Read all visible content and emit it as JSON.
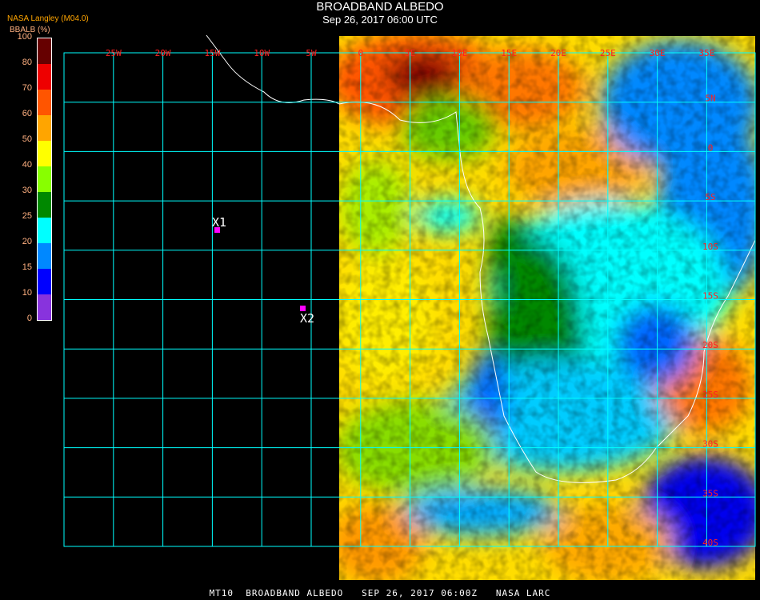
{
  "header": {
    "title": "BROADBAND ALBEDO",
    "subtitle": "Sep 26, 2017 06:00 UTC",
    "source": "NASA Langley (M04.0)",
    "unit": "BBALB (%)"
  },
  "legend": {
    "ticks": [
      "100",
      "80",
      "70",
      "60",
      "50",
      "40",
      "30",
      "25",
      "20",
      "15",
      "10",
      "0"
    ],
    "colors": [
      "#660000",
      "#ee0000",
      "#ff5500",
      "#ffa500",
      "#ffff00",
      "#88ff00",
      "#008800",
      "#00ffff",
      "#0088ff",
      "#0000ff",
      "#8833dd"
    ]
  },
  "map": {
    "lon_labels": [
      "25W",
      "20W",
      "15W",
      "10W",
      "5W",
      "0",
      "5E",
      "10E",
      "15E",
      "20E",
      "25E",
      "30E",
      "35E"
    ],
    "lat_labels": [
      "5N",
      "0",
      "5S",
      "10S",
      "15S",
      "20S",
      "25S",
      "30S",
      "35S",
      "40S"
    ],
    "grid_color": "#00ffff",
    "markers": [
      {
        "label": "X1",
        "color": "#ff00ff"
      },
      {
        "label": "X2",
        "color": "#ff00ff"
      }
    ]
  },
  "footer": "MT10  BROADBAND ALBEDO   SEP 26, 2017 06:00Z   NASA LARC"
}
